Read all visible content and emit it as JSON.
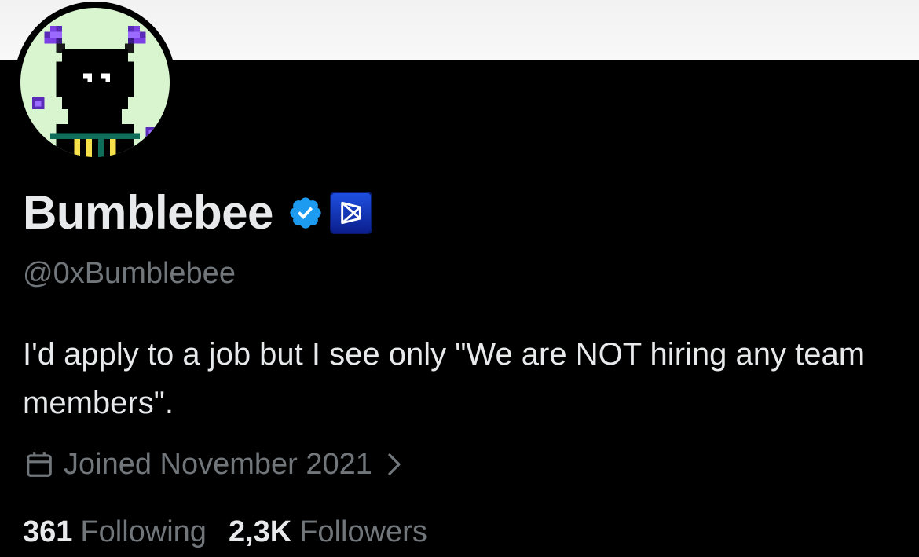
{
  "profile": {
    "display_name": "Bumblebee",
    "handle": "@0xBumblebee",
    "bio": "I'd apply to a job but I see only \"We are NOT hiring any team members\".",
    "joined": "Joined November 2021",
    "verified_icon": "verified-badge-icon",
    "affiliate_icon": "affiliate-badge-icon"
  },
  "stats": {
    "following_count": "361",
    "following_label": "Following",
    "followers_count": "2,3K",
    "followers_label": "Followers"
  },
  "colors": {
    "background": "#000000",
    "primary_text": "#e7e9ea",
    "secondary_text": "#71767b",
    "verified_blue": "#1d9bf0",
    "banner": "#f4f4f4",
    "avatar_bg": "#d8f5cf"
  }
}
